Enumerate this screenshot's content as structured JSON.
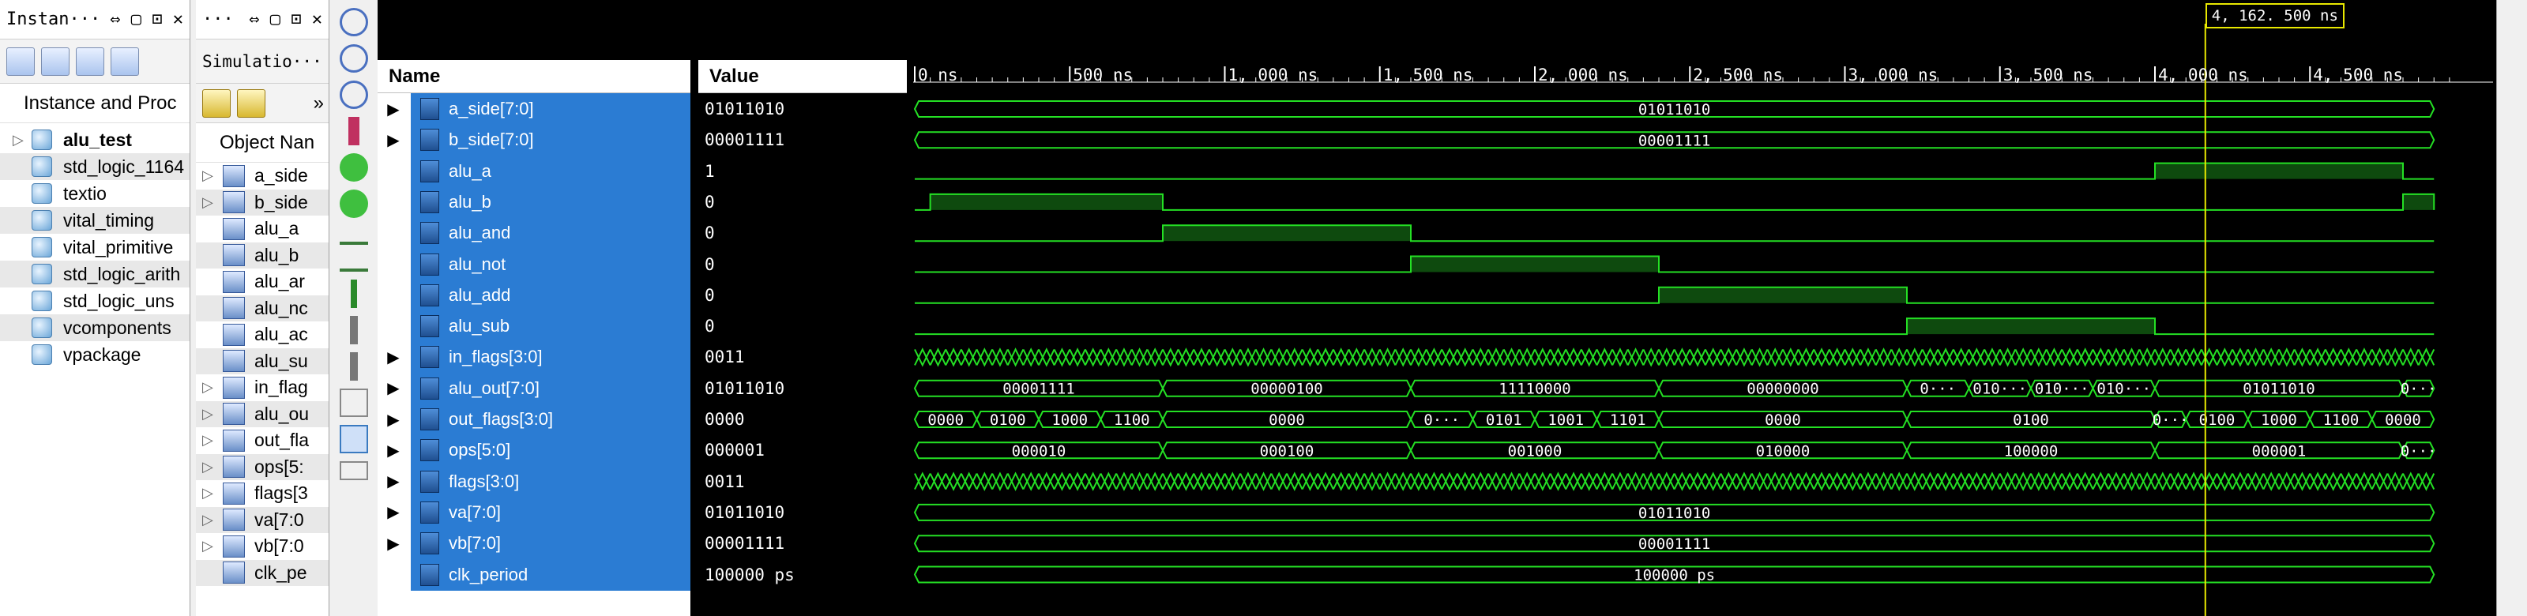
{
  "instance_panel": {
    "title": "Instan···",
    "controls": "⇔ ▢ ⊡ ✕",
    "header": "Instance and Proc",
    "items": [
      {
        "label": "alu_test",
        "bold": true,
        "expand": "▷"
      },
      {
        "label": "std_logic_1164"
      },
      {
        "label": "textio"
      },
      {
        "label": "vital_timing"
      },
      {
        "label": "vital_primitive"
      },
      {
        "label": "std_logic_arith"
      },
      {
        "label": "std_logic_uns"
      },
      {
        "label": "vcomponents"
      },
      {
        "label": "vpackage"
      }
    ]
  },
  "objects_panel": {
    "title": "···",
    "controls": "⇔ ▢ ⊡ ✕",
    "tab": "Simulatio···",
    "more": "»",
    "header": "Object Nan",
    "items": [
      {
        "label": "a_side",
        "expand": "▷"
      },
      {
        "label": "b_side",
        "expand": "▷"
      },
      {
        "label": "alu_a"
      },
      {
        "label": "alu_b"
      },
      {
        "label": "alu_ar"
      },
      {
        "label": "alu_nc"
      },
      {
        "label": "alu_ac"
      },
      {
        "label": "alu_su"
      },
      {
        "label": "in_flag",
        "expand": "▷"
      },
      {
        "label": "alu_ou",
        "expand": "▷"
      },
      {
        "label": "out_fla",
        "expand": "▷"
      },
      {
        "label": "ops[5:",
        "expand": "▷"
      },
      {
        "label": "flags[3",
        "expand": "▷"
      },
      {
        "label": "va[7:0",
        "expand": "▷"
      },
      {
        "label": "vb[7:0",
        "expand": "▷"
      },
      {
        "label": "clk_pe"
      }
    ]
  },
  "wave": {
    "name_header": "Name",
    "value_header": "Value",
    "cursor_label": "4, 162. 500 ns",
    "time_labels": [
      "0 ns",
      "500 ns",
      "1, 000 ns",
      "1, 500 ns",
      "2, 000 ns",
      "2, 500 ns",
      "3, 000 ns",
      "3, 500 ns",
      "4, 000 ns",
      "4, 500 ns"
    ],
    "signals": [
      {
        "name": "a_side[7:0]",
        "value": "01011010",
        "expand": "▶"
      },
      {
        "name": "b_side[7:0]",
        "value": "00001111",
        "expand": "▶"
      },
      {
        "name": "alu_a",
        "value": "1"
      },
      {
        "name": "alu_b",
        "value": "0"
      },
      {
        "name": "alu_and",
        "value": "0"
      },
      {
        "name": "alu_not",
        "value": "0"
      },
      {
        "name": "alu_add",
        "value": "0"
      },
      {
        "name": "alu_sub",
        "value": "0"
      },
      {
        "name": "in_flags[3:0]",
        "value": "0011",
        "expand": "▶"
      },
      {
        "name": "alu_out[7:0]",
        "value": "01011010",
        "expand": "▶"
      },
      {
        "name": "out_flags[3:0]",
        "value": "0000",
        "expand": "▶"
      },
      {
        "name": "ops[5:0]",
        "value": "000001",
        "expand": "▶"
      },
      {
        "name": "flags[3:0]",
        "value": "0011",
        "expand": "▶"
      },
      {
        "name": "va[7:0]",
        "value": "01011010",
        "expand": "▶"
      },
      {
        "name": "vb[7:0]",
        "value": "00001111",
        "expand": "▶"
      },
      {
        "name": "clk_period",
        "value": "100000 ps"
      }
    ],
    "traces": [
      {
        "kind": "bus",
        "segs": [
          {
            "t0": 0,
            "t1": 4900,
            "label": "01011010"
          }
        ]
      },
      {
        "kind": "bus",
        "segs": [
          {
            "t0": 0,
            "t1": 4900,
            "label": "00001111"
          }
        ]
      },
      {
        "kind": "bit",
        "edges": [
          0,
          0,
          50,
          1,
          4000,
          0,
          4800,
          1
        ],
        "hi": [
          {
            "t0": 4000,
            "t1": 4800
          }
        ]
      },
      {
        "kind": "bit",
        "edges": [
          0,
          0,
          50,
          1,
          800,
          0,
          4800,
          1
        ],
        "hi": [
          {
            "t0": 50,
            "t1": 800
          },
          {
            "t0": 4800,
            "t1": 4900
          }
        ]
      },
      {
        "kind": "bit",
        "hi": [
          {
            "t0": 800,
            "t1": 1600
          }
        ]
      },
      {
        "kind": "bit",
        "hi": [
          {
            "t0": 1600,
            "t1": 2400
          }
        ]
      },
      {
        "kind": "bit",
        "hi": [
          {
            "t0": 2400,
            "t1": 3200
          }
        ]
      },
      {
        "kind": "bit",
        "hi": [
          {
            "t0": 3200,
            "t1": 4000
          }
        ]
      },
      {
        "kind": "clock",
        "period": 50
      },
      {
        "kind": "bus",
        "segs": [
          {
            "t0": 0,
            "t1": 800,
            "label": "00001111"
          },
          {
            "t0": 800,
            "t1": 1600,
            "label": "00000100"
          },
          {
            "t0": 1600,
            "t1": 2400,
            "label": "11110000"
          },
          {
            "t0": 2400,
            "t1": 3200,
            "label": "00000000"
          },
          {
            "t0": 3200,
            "t1": 3400,
            "label": "0···"
          },
          {
            "t0": 3400,
            "t1": 3600,
            "label": "010···"
          },
          {
            "t0": 3600,
            "t1": 3800,
            "label": "010···"
          },
          {
            "t0": 3800,
            "t1": 4000,
            "label": "010···"
          },
          {
            "t0": 4000,
            "t1": 4800,
            "label": "01011010"
          },
          {
            "t0": 4800,
            "t1": 4900,
            "label": "0···"
          }
        ]
      },
      {
        "kind": "bus",
        "segs": [
          {
            "t0": 0,
            "t1": 200,
            "label": "0000"
          },
          {
            "t0": 200,
            "t1": 400,
            "label": "0100"
          },
          {
            "t0": 400,
            "t1": 600,
            "label": "1000"
          },
          {
            "t0": 600,
            "t1": 800,
            "label": "1100"
          },
          {
            "t0": 800,
            "t1": 1600,
            "label": "0000"
          },
          {
            "t0": 1600,
            "t1": 1800,
            "label": "0···"
          },
          {
            "t0": 1800,
            "t1": 2000,
            "label": "0101"
          },
          {
            "t0": 2000,
            "t1": 2200,
            "label": "1001"
          },
          {
            "t0": 2200,
            "t1": 2400,
            "label": "1101"
          },
          {
            "t0": 2400,
            "t1": 3200,
            "label": "0000"
          },
          {
            "t0": 3200,
            "t1": 4000,
            "label": "0100"
          },
          {
            "t0": 4000,
            "t1": 4100,
            "label": "0···"
          },
          {
            "t0": 4100,
            "t1": 4300,
            "label": "0100"
          },
          {
            "t0": 4300,
            "t1": 4500,
            "label": "1000"
          },
          {
            "t0": 4500,
            "t1": 4700,
            "label": "1100"
          },
          {
            "t0": 4700,
            "t1": 4900,
            "label": "0000"
          }
        ]
      },
      {
        "kind": "bus",
        "segs": [
          {
            "t0": 0,
            "t1": 800,
            "label": "000010"
          },
          {
            "t0": 800,
            "t1": 1600,
            "label": "000100"
          },
          {
            "t0": 1600,
            "t1": 2400,
            "label": "001000"
          },
          {
            "t0": 2400,
            "t1": 3200,
            "label": "010000"
          },
          {
            "t0": 3200,
            "t1": 4000,
            "label": "100000"
          },
          {
            "t0": 4000,
            "t1": 4800,
            "label": "000001"
          },
          {
            "t0": 4800,
            "t1": 4900,
            "label": "0···"
          }
        ]
      },
      {
        "kind": "clock",
        "period": 50
      },
      {
        "kind": "bus",
        "segs": [
          {
            "t0": 0,
            "t1": 4900,
            "label": "01011010"
          }
        ]
      },
      {
        "kind": "bus",
        "segs": [
          {
            "t0": 0,
            "t1": 4900,
            "label": "00001111"
          }
        ]
      },
      {
        "kind": "bus",
        "segs": [
          {
            "t0": 0,
            "t1": 4900,
            "label": "100000 ps"
          }
        ]
      }
    ],
    "cursor_time": 4162.5,
    "colors": {
      "trace": "#24e024",
      "fill": "#0e4a0e",
      "cursor": "#e8e800",
      "select": "#2b7cd3"
    }
  }
}
